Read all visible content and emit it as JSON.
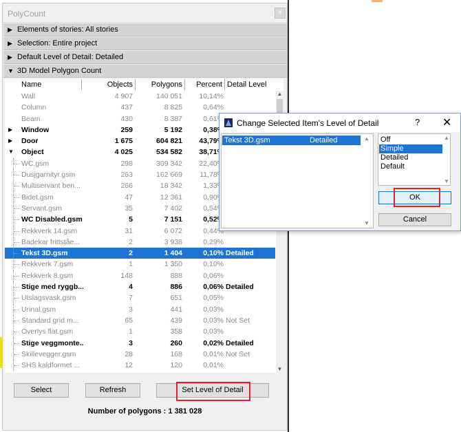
{
  "palette": {
    "title": "PolyCount",
    "close": "×",
    "sections": [
      {
        "label": "Elements of stories: All stories",
        "arrow": "▶"
      },
      {
        "label": "Selection: Entire project",
        "arrow": "▶"
      },
      {
        "label": "Default Level of Detail: Detailed",
        "arrow": "▶"
      },
      {
        "label": "3D Model Polygon Count",
        "arrow": "▼"
      }
    ],
    "columns": {
      "name": "Name",
      "objects": "Objects",
      "polygons": "Polygons",
      "percent": "Percent",
      "detail": "Detail Level"
    },
    "rows": [
      {
        "name": "Wall",
        "objects": "4 907",
        "polygons": "140 051",
        "percent": "10,14%",
        "detail": "",
        "style": "dim",
        "exp": "",
        "child": false
      },
      {
        "name": "Column",
        "objects": "437",
        "polygons": "8 825",
        "percent": "0,64%",
        "detail": "",
        "style": "dim",
        "exp": "",
        "child": false
      },
      {
        "name": "Beam",
        "objects": "430",
        "polygons": "8 387",
        "percent": "0,61%",
        "detail": "",
        "style": "dim",
        "exp": "",
        "child": false
      },
      {
        "name": "Window",
        "objects": "259",
        "polygons": "5 192",
        "percent": "0,38%",
        "detail": "",
        "style": "bold",
        "exp": "▶",
        "child": false
      },
      {
        "name": "Door",
        "objects": "1 675",
        "polygons": "604 821",
        "percent": "43,79%",
        "detail": "",
        "style": "bold",
        "exp": "▶",
        "child": false
      },
      {
        "name": "Object",
        "objects": "4 025",
        "polygons": "534 582",
        "percent": "38,71%",
        "detail": "",
        "style": "bold",
        "exp": "▼",
        "child": false
      },
      {
        "name": "WC.gsm",
        "objects": "298",
        "polygons": "309 342",
        "percent": "22,40%",
        "detail": "",
        "style": "dim",
        "exp": "",
        "child": true
      },
      {
        "name": "Dusjgarnityr.gsm",
        "objects": "263",
        "polygons": "162 669",
        "percent": "11,78%",
        "detail": "",
        "style": "dim",
        "exp": "",
        "child": true
      },
      {
        "name": "Multiservant ben...",
        "objects": "266",
        "polygons": "18 342",
        "percent": "1,33%",
        "detail": "",
        "style": "dim",
        "exp": "",
        "child": true
      },
      {
        "name": "Bidet.gsm",
        "objects": "47",
        "polygons": "12 361",
        "percent": "0,90%",
        "detail": "",
        "style": "dim",
        "exp": "",
        "child": true
      },
      {
        "name": "Servant.gsm",
        "objects": "35",
        "polygons": "7 402",
        "percent": "0,54%",
        "detail": "",
        "style": "dim",
        "exp": "",
        "child": true
      },
      {
        "name": "WC Disabled.gsm",
        "objects": "5",
        "polygons": "7 151",
        "percent": "0,52%",
        "detail": "",
        "style": "bold",
        "exp": "",
        "child": true
      },
      {
        "name": "Rekkverk 14.gsm",
        "objects": "31",
        "polygons": "6 072",
        "percent": "0,44%",
        "detail": "",
        "style": "dim",
        "exp": "",
        "child": true
      },
      {
        "name": "Badekar frittståe...",
        "objects": "2",
        "polygons": "3 938",
        "percent": "0,29%",
        "detail": "",
        "style": "dim",
        "exp": "",
        "child": true
      },
      {
        "name": "Tekst 3D.gsm",
        "objects": "2",
        "polygons": "1 404",
        "percent": "0,10%",
        "detail": "Detailed",
        "style": "sel",
        "exp": "",
        "child": true
      },
      {
        "name": "Rekkverk 7.gsm",
        "objects": "1",
        "polygons": "1 350",
        "percent": "0,10%",
        "detail": "",
        "style": "dim",
        "exp": "",
        "child": true
      },
      {
        "name": "Rekkverk 8.gsm",
        "objects": "148",
        "polygons": "888",
        "percent": "0,06%",
        "detail": "",
        "style": "dim",
        "exp": "",
        "child": true
      },
      {
        "name": "Stige med ryggb...",
        "objects": "4",
        "polygons": "886",
        "percent": "0,06%",
        "detail": "Detailed",
        "style": "bold",
        "exp": "",
        "child": true
      },
      {
        "name": "Utslagsvask.gsm",
        "objects": "7",
        "polygons": "651",
        "percent": "0,05%",
        "detail": "",
        "style": "dim",
        "exp": "",
        "child": true
      },
      {
        "name": "Urinal.gsm",
        "objects": "3",
        "polygons": "441",
        "percent": "0,03%",
        "detail": "",
        "style": "dim",
        "exp": "",
        "child": true
      },
      {
        "name": "Standard grid m...",
        "objects": "65",
        "polygons": "439",
        "percent": "0,03%",
        "detail": "Not Set",
        "style": "dim",
        "exp": "",
        "child": true
      },
      {
        "name": "Overlys flat.gsm",
        "objects": "1",
        "polygons": "358",
        "percent": "0,03%",
        "detail": "",
        "style": "dim",
        "exp": "",
        "child": true
      },
      {
        "name": "Stige veggmonte...",
        "objects": "3",
        "polygons": "260",
        "percent": "0,02%",
        "detail": "Detailed",
        "style": "bold",
        "exp": "",
        "child": true
      },
      {
        "name": "Skillevegger.gsm",
        "objects": "28",
        "polygons": "168",
        "percent": "0,01%",
        "detail": "Not Set",
        "style": "dim",
        "exp": "",
        "child": true
      },
      {
        "name": "SHS kaldformet ...",
        "objects": "12",
        "polygons": "120",
        "percent": "0,01%",
        "detail": "",
        "style": "dim",
        "exp": "",
        "child": true
      }
    ],
    "buttons": {
      "select": "Select",
      "refresh": "Refresh",
      "set_level": "Set Level of Detail"
    },
    "total": "Number of polygons : 1 381 028"
  },
  "dialog": {
    "title": "Change Selected Item's Level of Detail",
    "help": "?",
    "close": "✕",
    "item_name": "Tekst 3D.gsm",
    "item_detail": "Detailed",
    "options": [
      "Off",
      "Simple",
      "Detailed",
      "Default"
    ],
    "selected_option": "Simple",
    "ok": "OK",
    "cancel": "Cancel"
  },
  "colors": {
    "selection": "#1e74d2",
    "highlight_box": "#e0202a"
  }
}
